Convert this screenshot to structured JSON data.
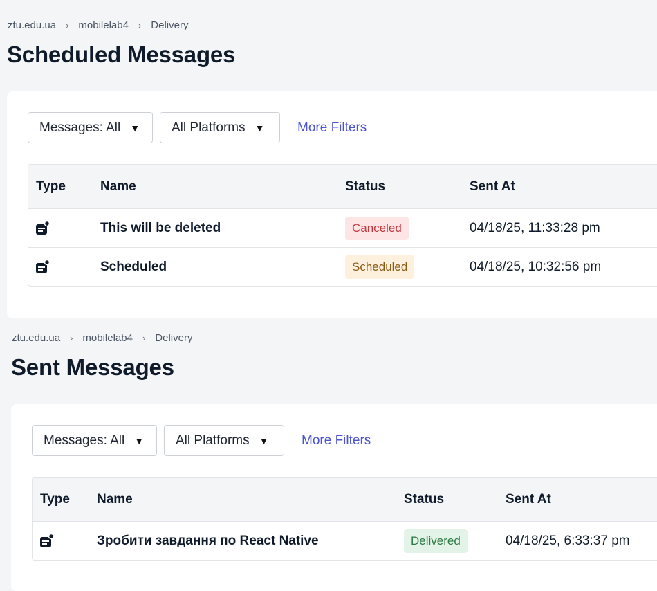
{
  "scheduled": {
    "breadcrumb": [
      "ztu.edu.ua",
      "mobilelab4",
      "Delivery"
    ],
    "title": "Scheduled Messages",
    "filters": {
      "messages": "Messages: All",
      "platforms": "All Platforms",
      "more": "More Filters"
    },
    "columns": {
      "type": "Type",
      "name": "Name",
      "status": "Status",
      "sent_at": "Sent At"
    },
    "rows": [
      {
        "icon": "message-card-icon",
        "name": "This will be deleted",
        "status": "Canceled",
        "sent_at": "04/18/25, 11:33:28 pm"
      },
      {
        "icon": "message-card-icon",
        "name": "Scheduled",
        "status": "Scheduled",
        "sent_at": "04/18/25, 10:32:56 pm"
      }
    ]
  },
  "sent": {
    "breadcrumb": [
      "ztu.edu.ua",
      "mobilelab4",
      "Delivery"
    ],
    "title": "Sent Messages",
    "filters": {
      "messages": "Messages: All",
      "platforms": "All Platforms",
      "more": "More Filters"
    },
    "columns": {
      "type": "Type",
      "name": "Name",
      "status": "Status",
      "sent_at": "Sent At"
    },
    "rows": [
      {
        "icon": "message-card-icon",
        "name": "Зробити завдання по React Native",
        "status": "Delivered",
        "sent_at": "04/18/25, 6:33:37 pm"
      }
    ]
  },
  "colors": {
    "link": "#4a54cf",
    "canceled": "#c4383f",
    "scheduled": "#8a5a12",
    "delivered": "#2c7a43"
  }
}
